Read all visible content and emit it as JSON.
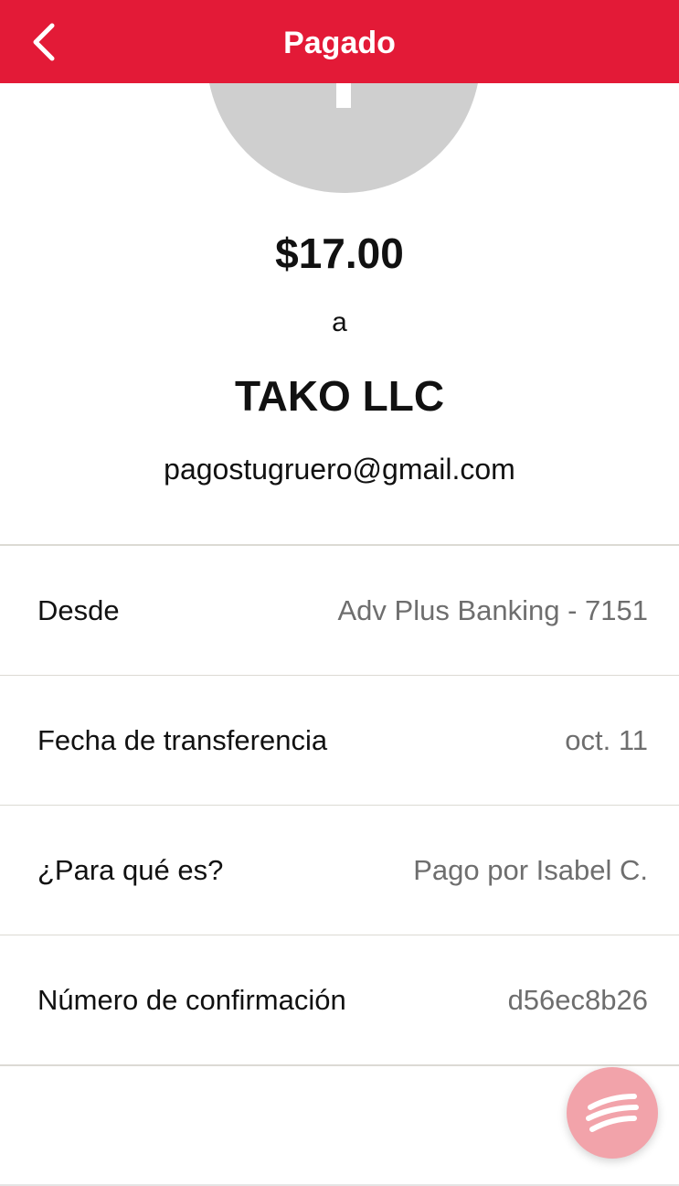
{
  "header": {
    "title": "Pagado",
    "background_color": "#e31a37",
    "back_icon": "chevron-left-icon"
  },
  "payment": {
    "amount": "$17.00",
    "to_word": "a",
    "payee_name": "TAKO LLC",
    "payee_email": "pagostugruero@gmail.com"
  },
  "details": {
    "from_label": "Desde",
    "from_value": "Adv Plus Banking - 7151",
    "date_label": "Fecha de transferencia",
    "date_value": "oct. 11",
    "memo_label": "¿Para qué es?",
    "memo_value": "Pago por Isabel C.",
    "confirmation_label": "Número de confirmación",
    "confirmation_value": "d56ec8b26"
  },
  "fab": {
    "icon": "chat-stripes-icon",
    "color": "#f2a3aa"
  }
}
